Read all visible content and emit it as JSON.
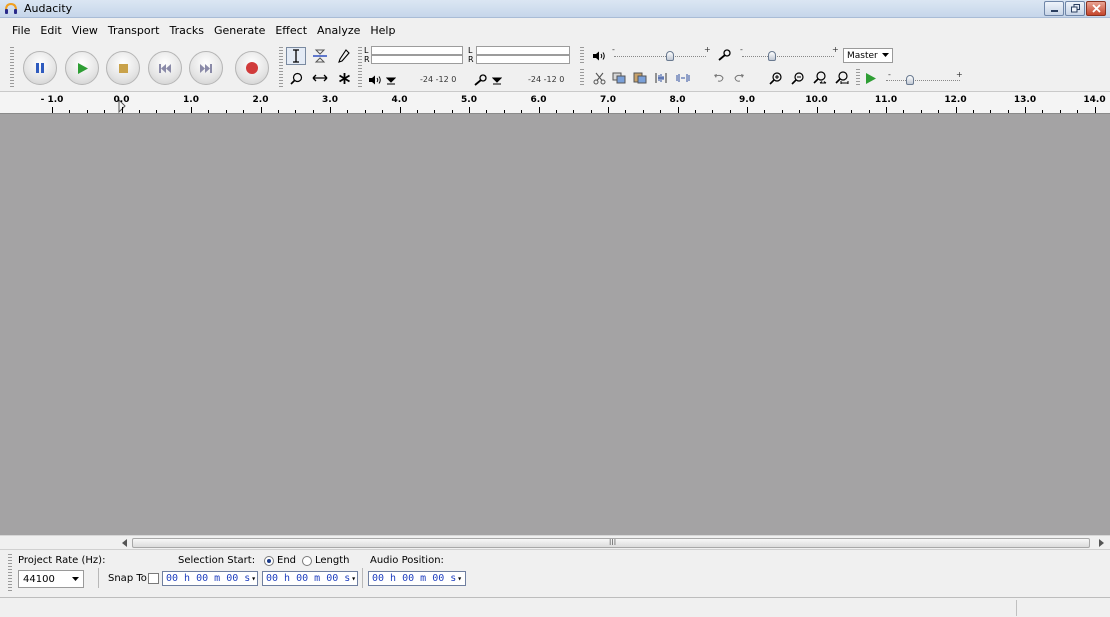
{
  "window": {
    "title": "Audacity"
  },
  "menu": [
    {
      "label": "File"
    },
    {
      "label": "Edit"
    },
    {
      "label": "View"
    },
    {
      "label": "Transport"
    },
    {
      "label": "Tracks"
    },
    {
      "label": "Generate"
    },
    {
      "label": "Effect"
    },
    {
      "label": "Analyze"
    },
    {
      "label": "Help"
    }
  ],
  "meters": {
    "left": "L",
    "right": "R",
    "scale": "-24 -12 0"
  },
  "mixer": {
    "minus": "-",
    "plus": "+",
    "input_source": "Master"
  },
  "ruler": {
    "labels": [
      "- 1.0",
      "0.0",
      "1.0",
      "2.0",
      "3.0",
      "4.0",
      "5.0",
      "6.0",
      "7.0",
      "8.0",
      "9.0",
      "10.0",
      "11.0",
      "12.0",
      "13.0",
      "14.0"
    ]
  },
  "selection_bar": {
    "project_rate_label": "Project Rate (Hz):",
    "project_rate_value": "44100",
    "snap_to_label": "Snap To",
    "selection_start_label": "Selection Start:",
    "end_label": "End",
    "length_label": "Length",
    "audio_position_label": "Audio Position:",
    "selection_start_value": "00 h 00 m 00 s",
    "selection_end_value": "00 h 00 m 00 s",
    "audio_position_value": "00 h 00 m 00 s"
  },
  "scrollbar": {
    "grip": "III"
  },
  "colors": {
    "track_background": "#a4a3a4",
    "play_green": "#2e9e34",
    "record_red": "#d13b3b",
    "pause_blue": "#2f5bbf"
  }
}
